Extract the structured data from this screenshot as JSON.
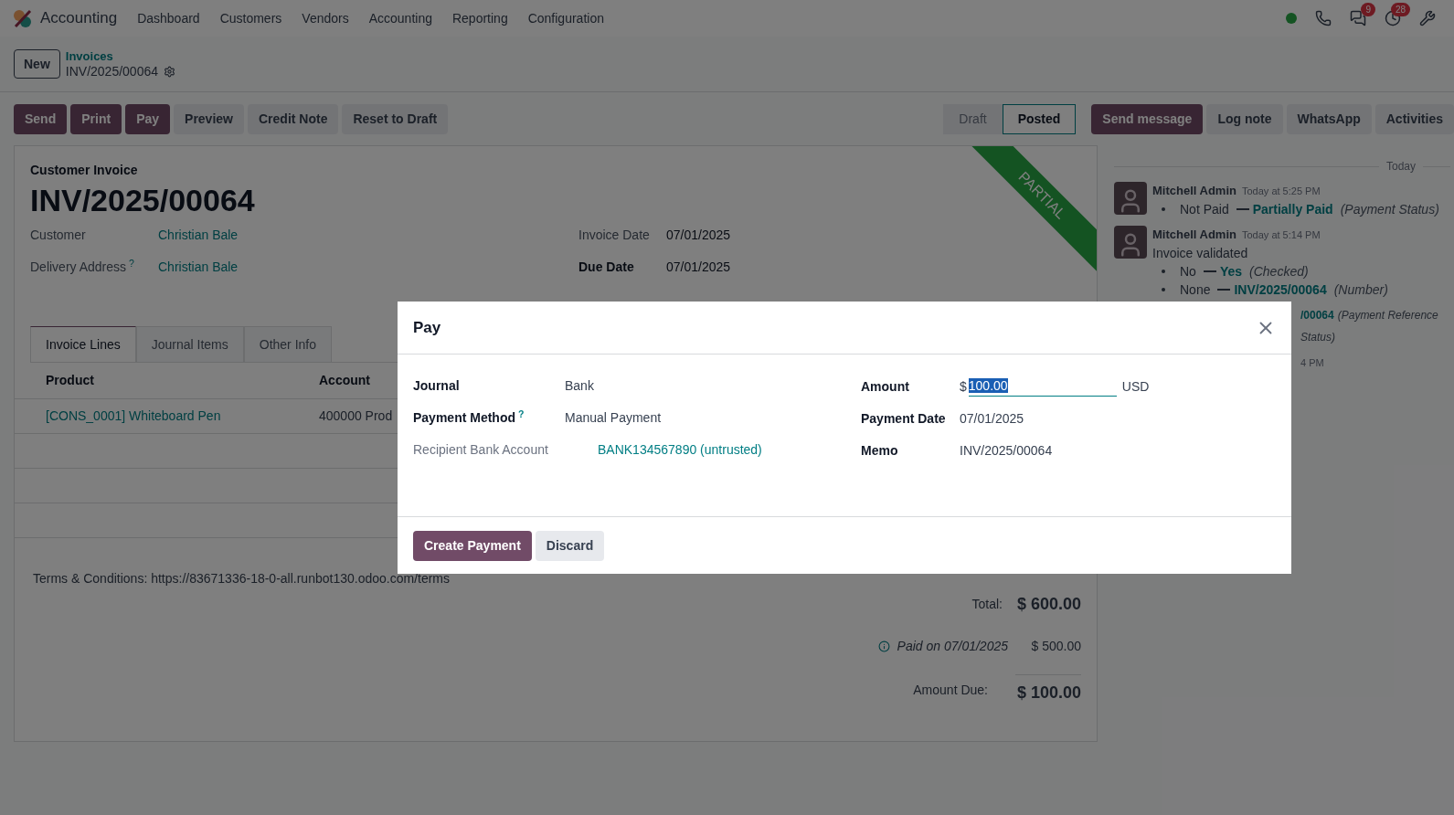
{
  "navbar": {
    "app_name": "Accounting",
    "menu": [
      "Dashboard",
      "Customers",
      "Vendors",
      "Accounting",
      "Reporting",
      "Configuration"
    ],
    "systray": [
      {
        "kind": "status"
      },
      {
        "kind": "phone"
      },
      {
        "kind": "chat",
        "badge": "9"
      },
      {
        "kind": "activity",
        "badge": "28"
      },
      {
        "kind": "debug"
      }
    ]
  },
  "breadcrumb": {
    "new_button": "New",
    "parent": "Invoices",
    "current": "INV/2025/00064"
  },
  "actions": [
    {
      "label": "Send",
      "primary": true
    },
    {
      "label": "Print",
      "primary": true
    },
    {
      "label": "Pay",
      "primary": true
    },
    {
      "label": "Preview",
      "primary": false
    },
    {
      "label": "Credit Note",
      "primary": false
    },
    {
      "label": "Reset to Draft",
      "primary": false
    }
  ],
  "status_bar": [
    {
      "label": "Draft",
      "selected": false
    },
    {
      "label": "Posted",
      "selected": true
    }
  ],
  "chatter_buttons": [
    {
      "label": "Send message",
      "primary": true
    },
    {
      "label": "Log note",
      "primary": false
    },
    {
      "label": "WhatsApp",
      "primary": false
    },
    {
      "label": "Activities",
      "primary": false
    }
  ],
  "form": {
    "type_label": "Customer Invoice",
    "number": "INV/2025/00064",
    "ribbon": "PARTIAL",
    "left_fields": [
      {
        "label": "Customer",
        "value": "Christian Bale"
      },
      {
        "label": "Delivery Address",
        "help": "?",
        "value": "Christian Bale"
      }
    ],
    "right_fields": [
      {
        "label": "Invoice Date",
        "value": "07/01/2025",
        "bold": false
      },
      {
        "label": "Due Date",
        "value": "07/01/2025",
        "bold": true
      }
    ],
    "tabs": [
      {
        "label": "Invoice Lines",
        "selected": true
      },
      {
        "label": "Journal Items",
        "selected": false
      },
      {
        "label": "Other Info",
        "selected": false
      }
    ],
    "table": {
      "columns": [
        "Product",
        "Account"
      ],
      "rows": [
        [
          "[CONS_0001] Whiteboard Pen",
          "400000 Prod"
        ]
      ]
    },
    "terms": "Terms & Conditions: https://83671336-18-0-all.runbot130.odoo.com/terms",
    "totals": {
      "total_label": "Total:",
      "total": "$ 600.00",
      "paid_label": "Paid on 07/01/2025",
      "paid": "$ 500.00",
      "due_label": "Amount Due:",
      "due": "$ 100.00"
    }
  },
  "chatter": {
    "date": "Today",
    "messages": [
      {
        "author": "Mitchell Admin",
        "time": "Today at 5:25 PM",
        "lines": [
          {
            "old": "Not Paid",
            "new": "Partially Paid",
            "field": "(Payment Status)"
          }
        ]
      },
      {
        "author": "Mitchell Admin",
        "time": "Today at 5:14 PM",
        "body": "Invoice validated",
        "lines": [
          {
            "old": "No",
            "new": "Yes",
            "field": "(Checked)"
          },
          {
            "old": "None",
            "new": "INV/2025/00064",
            "field": "(Number)"
          }
        ]
      }
    ],
    "partial_lines": [
      {
        "new": "/00064",
        "field": "(Payment Reference"
      },
      {
        "field": "Status)"
      }
    ],
    "partial_time": "4 PM"
  },
  "dialog": {
    "title": "Pay",
    "left": [
      {
        "label": "Journal",
        "value": "Bank",
        "bold": true,
        "kind": "text"
      },
      {
        "label": "Payment Method",
        "help": "?",
        "value": "Manual Payment",
        "bold": true,
        "kind": "text"
      },
      {
        "label": "Recipient Bank Account",
        "value": "BANK134567890 (untrusted)",
        "bold": false,
        "kind": "link"
      }
    ],
    "amount": {
      "label": "Amount",
      "symbol": "$",
      "value": "100.00",
      "value_selected": true,
      "currency": "USD"
    },
    "right": [
      {
        "label": "Payment Date",
        "value": "07/01/2025"
      },
      {
        "label": "Memo",
        "value": "INV/2025/00064"
      }
    ],
    "buttons": [
      {
        "label": "Create Payment",
        "primary": true
      },
      {
        "label": "Discard",
        "primary": false
      }
    ]
  }
}
